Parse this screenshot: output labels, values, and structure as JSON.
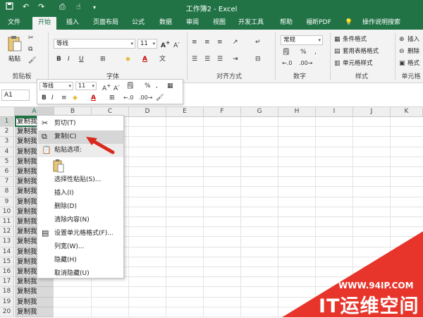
{
  "app": {
    "title": "工作簿2 - Excel",
    "accent": "#217346"
  },
  "quick_access": {
    "icons": [
      "save-icon",
      "undo-icon",
      "redo-icon",
      "print-preview-icon",
      "touch-mode-icon",
      "customize-icon"
    ]
  },
  "tabs": [
    {
      "label": "文件"
    },
    {
      "label": "开始"
    },
    {
      "label": "插入"
    },
    {
      "label": "页面布局"
    },
    {
      "label": "公式"
    },
    {
      "label": "数据"
    },
    {
      "label": "审阅"
    },
    {
      "label": "视图"
    },
    {
      "label": "开发工具"
    },
    {
      "label": "帮助"
    },
    {
      "label": "福昕PDF"
    },
    {
      "label": "操作说明搜索"
    }
  ],
  "ribbon": {
    "clipboard": {
      "paste_label": "粘贴",
      "group_label": "剪贴板"
    },
    "font": {
      "name": "等线",
      "size": "11",
      "group_label": "字体"
    },
    "alignment": {
      "group_label": "对齐方式"
    },
    "number": {
      "format": "常规",
      "group_label": "数字"
    },
    "styles": {
      "conditional_format": "条件格式",
      "table_format": "套用表格格式",
      "cell_styles": "单元格样式",
      "group_label": "样式"
    },
    "cells": {
      "insert": "插入",
      "delete": "删除",
      "format": "格式",
      "group_label": "单元格"
    }
  },
  "formula_bar": {
    "name_box": "A1"
  },
  "mini_toolbar": {
    "font": "等线",
    "size": "11"
  },
  "grid": {
    "columns": [
      "A",
      "B",
      "C",
      "D",
      "E",
      "F",
      "G",
      "H",
      "I",
      "J",
      "K"
    ],
    "rows": [
      "1",
      "2",
      "3",
      "4",
      "5",
      "6",
      "7",
      "8",
      "9",
      "10",
      "11",
      "12",
      "13",
      "14",
      "15",
      "16",
      "17",
      "18",
      "19",
      "20"
    ],
    "cell_text": "复制我"
  },
  "context_menu": {
    "items": [
      {
        "label": "剪切(T)",
        "icon": "scissors-icon"
      },
      {
        "label": "复制(C)",
        "icon": "copy-icon",
        "highlighted": true
      },
      {
        "label": "粘贴选项:",
        "icon": "paste-icon",
        "header": true
      },
      {
        "label": "",
        "icon": "paste-option-icon"
      },
      {
        "label": "选择性粘贴(S)...",
        "icon": ""
      },
      {
        "label": "插入(I)",
        "icon": ""
      },
      {
        "label": "删除(D)",
        "icon": ""
      },
      {
        "label": "清除内容(N)",
        "icon": ""
      },
      {
        "label": "设置单元格格式(F)...",
        "icon": "format-cells-icon"
      },
      {
        "label": "列宽(W)...",
        "icon": ""
      },
      {
        "label": "隐藏(H)",
        "icon": ""
      },
      {
        "label": "取消隐藏(U)",
        "icon": ""
      }
    ]
  },
  "watermark": {
    "url": "WWW.94IP.COM",
    "brand": "IT运维空间",
    "color": "#e7352b"
  }
}
